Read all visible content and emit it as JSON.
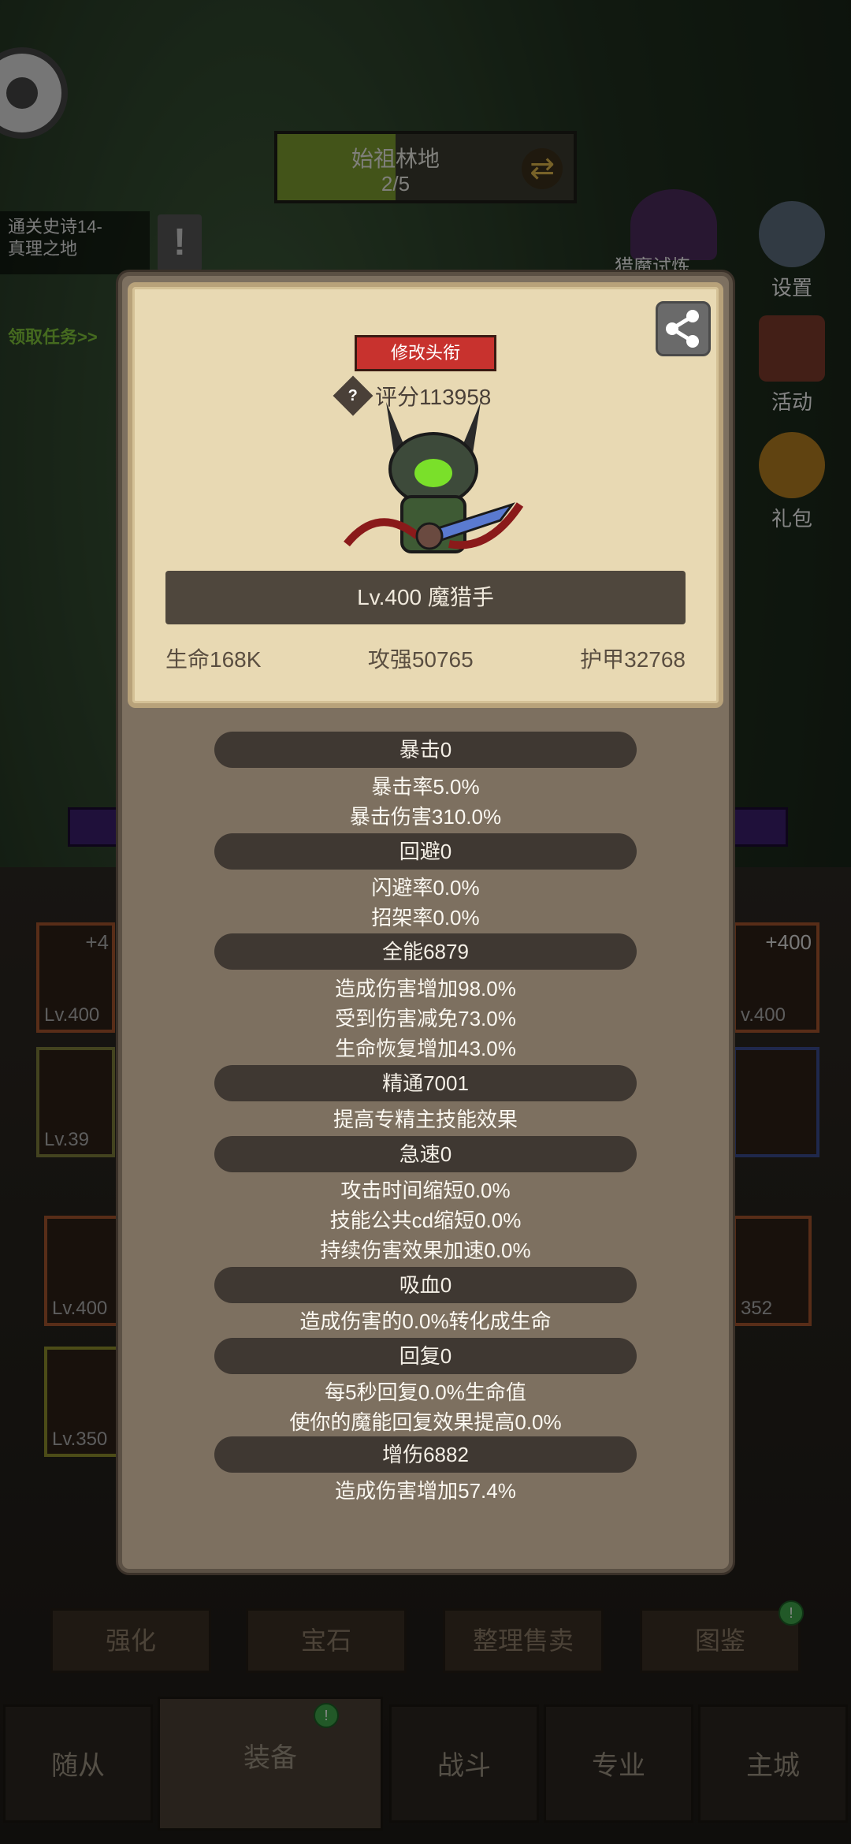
{
  "background": {
    "zone_title": "始祖林地",
    "zone_progress": "2/5",
    "zone_progress_fraction": 0.4,
    "quest_text": "通关史诗14-\n真理之地",
    "quest_link": "领取任务>>",
    "hunt_label": "猎魔试炼",
    "settings_label": "设置",
    "activity_label": "活动",
    "gift_label": "礼包",
    "left_slots": [
      "Lv.400",
      "Lv.39",
      "Lv.400",
      "Lv.350"
    ],
    "right_slots": [
      "+400",
      "v.400",
      "352"
    ],
    "left_plus": "+4",
    "bottom_tabs": [
      "强化",
      "宝石",
      "整理售卖",
      "图鉴"
    ],
    "nav": [
      "随从",
      "装备",
      "战斗",
      "专业",
      "主城"
    ]
  },
  "card": {
    "title_button": "修改头衔",
    "score": "评分113958",
    "level_name": "Lv.400 魔猎手",
    "hp": "生命168K",
    "attack": "攻强50765",
    "armor": "护甲32768"
  },
  "sections": [
    {
      "title": "暴击0",
      "lines": [
        "暴击率5.0%",
        "暴击伤害310.0%"
      ]
    },
    {
      "title": "回避0",
      "lines": [
        "闪避率0.0%",
        "招架率0.0%"
      ]
    },
    {
      "title": "全能6879",
      "lines": [
        "造成伤害增加98.0%",
        "受到伤害减免73.0%",
        "生命恢复增加43.0%"
      ]
    },
    {
      "title": "精通7001",
      "lines": [
        "提高专精主技能效果"
      ]
    },
    {
      "title": "急速0",
      "lines": [
        "攻击时间缩短0.0%",
        "技能公共cd缩短0.0%",
        "持续伤害效果加速0.0%"
      ]
    },
    {
      "title": "吸血0",
      "lines": [
        "造成伤害的0.0%转化成生命"
      ]
    },
    {
      "title": "回复0",
      "lines": [
        "每5秒回复0.0%生命值",
        "使你的魔能回复效果提高0.0%"
      ]
    },
    {
      "title": "增伤6882",
      "lines": [
        "造成伤害增加57.4%"
      ]
    }
  ]
}
